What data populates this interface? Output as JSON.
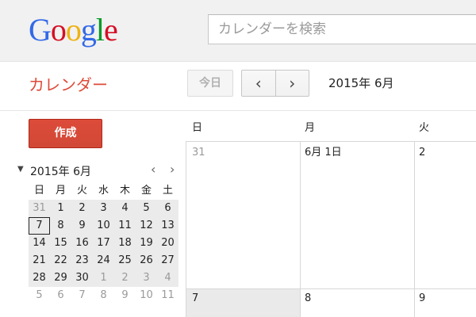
{
  "header": {
    "logo_letters": [
      {
        "char": "G",
        "color": "#3369e8"
      },
      {
        "char": "o",
        "color": "#d50f25"
      },
      {
        "char": "o",
        "color": "#eeb211"
      },
      {
        "char": "g",
        "color": "#3369e8"
      },
      {
        "char": "l",
        "color": "#009925"
      },
      {
        "char": "e",
        "color": "#d50f25"
      }
    ],
    "search_placeholder": "カレンダーを検索"
  },
  "subheader": {
    "app_title": "カレンダー",
    "today_label": "今日",
    "prev_label": "‹",
    "next_label": "›",
    "period_label": "2015年 6月"
  },
  "sidebar": {
    "create_label": "作成",
    "mini_calendar": {
      "toggle": "▼",
      "title": "2015年 6月",
      "prev": "‹",
      "next": "›",
      "weekdays": [
        "日",
        "月",
        "火",
        "水",
        "木",
        "金",
        "土"
      ],
      "weeks": [
        [
          "31",
          "1",
          "2",
          "3",
          "4",
          "5",
          "6"
        ],
        [
          "7",
          "8",
          "9",
          "10",
          "11",
          "12",
          "13"
        ],
        [
          "14",
          "15",
          "16",
          "17",
          "18",
          "19",
          "20"
        ],
        [
          "21",
          "22",
          "23",
          "24",
          "25",
          "26",
          "27"
        ],
        [
          "28",
          "29",
          "30",
          "1",
          "2",
          "3",
          "4"
        ],
        [
          "5",
          "6",
          "7",
          "8",
          "9",
          "10",
          "11"
        ]
      ],
      "selected": "7"
    }
  },
  "month_view": {
    "weekdays": [
      "日",
      "月",
      "火"
    ],
    "weeks": [
      [
        "31",
        "6月 1日",
        "2"
      ],
      [
        "7",
        "8",
        "9"
      ]
    ]
  }
}
